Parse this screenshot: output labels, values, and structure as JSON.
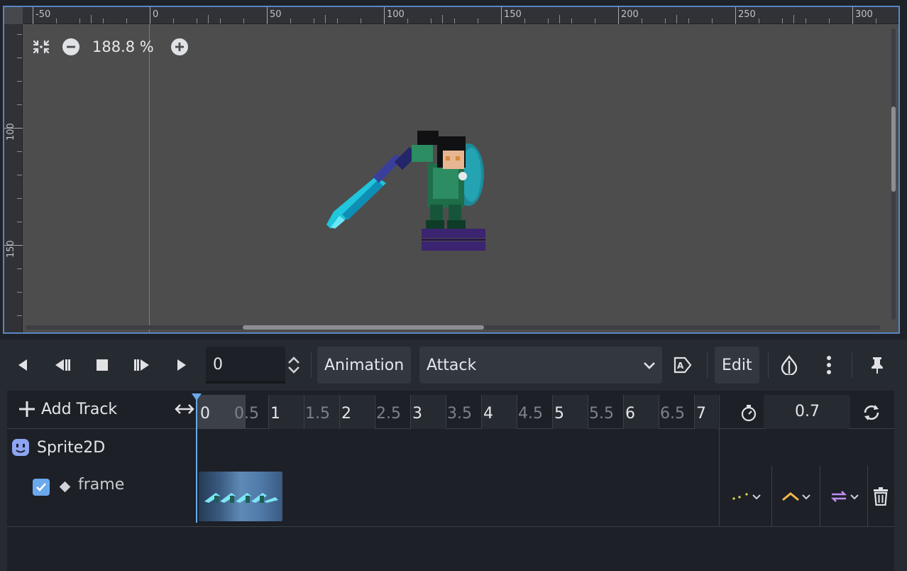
{
  "viewport": {
    "ruler_h_labels": [
      "-50",
      "0",
      "50",
      "100",
      "150",
      "200",
      "250",
      "300"
    ],
    "ruler_v_labels": [
      "100",
      "150"
    ],
    "zoom_label": "188.8 %"
  },
  "animation": {
    "time_value": "0",
    "animation_button": "Animation",
    "selected_animation": "Attack",
    "edit_button": "Edit",
    "add_track": "Add Track",
    "timeline_labels": [
      "0",
      "0.5",
      "1",
      "1.5",
      "2",
      "2.5",
      "3",
      "3.5",
      "4",
      "4.5",
      "5",
      "5.5",
      "6",
      "6.5",
      "7"
    ],
    "length_value": "0.7",
    "node_name": "Sprite2D",
    "track_name": "frame"
  },
  "colors": {
    "accent": "#6aa9ee",
    "interp_icon": "#e7e04a",
    "update_icon": "#f2b84a",
    "loop_icon": "#c08cf0"
  }
}
